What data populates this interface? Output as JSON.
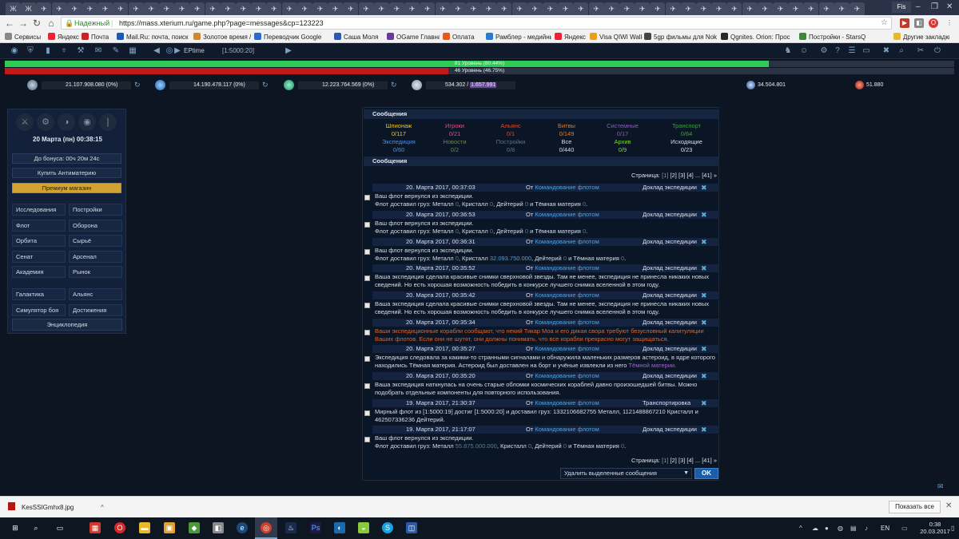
{
  "browser": {
    "tab_glyphs": [
      "Ж",
      "Ж",
      "✈",
      "✈",
      "✈",
      "✈",
      "✈",
      "✈",
      "✈",
      "✈",
      "✈",
      "✈",
      "✈",
      "✈",
      "✈",
      "✈",
      "✈",
      "✈",
      "✈",
      "✈",
      "✈",
      "✈",
      "✈",
      "✈",
      "✈",
      "✈",
      "✈",
      "✈",
      "✈",
      "✈",
      "✈",
      "✈",
      "✈",
      "✈",
      "✈",
      "✈",
      "✈",
      "✈",
      "✈",
      "✈",
      "✈",
      "✈",
      "✈",
      "✈",
      "✈",
      "✈",
      "✈",
      "✈",
      "✈",
      "✈",
      "✈",
      "✈",
      "✈",
      "✈",
      "✈",
      "✈",
      "✈",
      "✈"
    ],
    "profile": "Fis",
    "security_label": "Надежный",
    "url": "https://mass.xterium.ru/game.php?page=messages&cp=123223",
    "bookmarks": [
      "Сервисы",
      "Яндекс",
      "Почта",
      "Mail.Ru: почта, поиск",
      "Золотое время / Gol",
      "Переводчик Google",
      "Саша Моля",
      "OGame Главная",
      "Оплата",
      "Рамблер - медийный",
      "Яндекс",
      "Visa QIWI Wallet",
      "5gp фильмы для Nok",
      "Qgnites. Orion: Прос",
      "Постройки - StarsQ",
      "Другие закладки"
    ],
    "colors": {
      "secure": "#2a8a2a"
    }
  },
  "game": {
    "ep_name": "EPtime",
    "ep_coords": "[1:5000:20]",
    "level1": {
      "text": "81 Уровень (80.44%)",
      "progress_pct": 80.44
    },
    "level2": {
      "text": "46 Уровень (46.75%)",
      "progress_pct": 46.75
    },
    "resources": {
      "metal": "21.107.908.080 (0%)",
      "crystal": "14.190.478.117 (0%)",
      "deuterium": "12.223.764.569 (0%)",
      "energy_used": "534.302 / ",
      "energy_total": "1.657.991",
      "darkmatter": "34.504.801",
      "antimatter": "51.880"
    },
    "side": {
      "datetime": "20 Марта (пн) 00:38:15",
      "bonus": "До бонуса: 00ч 20м 24с",
      "buy_antimatter": "Купить Антиматерию",
      "premium": "Премиум магазин",
      "nav": [
        [
          "Исследования",
          "Постройки"
        ],
        [
          "Флот",
          "Оборона"
        ],
        [
          "Орбита",
          "Сырьё"
        ],
        [
          "Сенат",
          "Арсенал"
        ],
        [
          "Академия",
          "Рынок"
        ]
      ],
      "nav2": [
        [
          "Галактика",
          "Альянс"
        ],
        [
          "Симулятор боя",
          "Достижения"
        ]
      ],
      "encyclopedia": "Энциклопедия"
    },
    "messages": {
      "header": "Сообщения",
      "header2": "Сообщения",
      "categories": [
        {
          "name": "Шпионаж",
          "count": "0/117",
          "color": "#e8c531"
        },
        {
          "name": "Игроки",
          "count": "0/21",
          "color": "#e64c8c"
        },
        {
          "name": "Альянс",
          "count": "0/1",
          "color": "#e24a2a"
        },
        {
          "name": "Битвы",
          "count": "0/149",
          "color": "#e87a1e"
        },
        {
          "name": "Системные",
          "count": "0/17",
          "color": "#8e5ac4"
        },
        {
          "name": "Транспорт",
          "count": "0/64",
          "color": "#3e9e3e"
        },
        {
          "name": "Экспедиция",
          "count": "0/60",
          "color": "#4e8ee0"
        },
        {
          "name": "Новости",
          "count": "0/2",
          "color": "#6a8a4e"
        },
        {
          "name": "Постройки",
          "count": "0/8",
          "color": "#5f6f86"
        },
        {
          "name": "Все",
          "count": "0/440",
          "color": "#d6dee8"
        },
        {
          "name": "Архив",
          "count": "0/9",
          "color": "#7ed83a"
        },
        {
          "name": "Исходящие",
          "count": "0/23",
          "color": "#d6dee8"
        }
      ],
      "pager": {
        "label": "Страница:",
        "p1": "[1]",
        "p2": "[2]",
        "p3": "[3]",
        "p4": "[4]",
        "dots": "...",
        "plast": "[41]",
        "arrow": "»"
      },
      "from_prefix": "От",
      "items": [
        {
          "date": "20. Марта 2017, 00:37:03",
          "from": "Командование флотом",
          "subject": "Доклад экспедиции",
          "l1": "Ваш флот вернулся из экспедиции.",
          "g1": "Флот доставил груз: Металл",
          "v1": "0",
          ", Кристалл": ", Кристалл",
          "v2": "0",
          "dt": ", Дейтерий",
          "v3": "0",
          "tm": "и Тёмная материя",
          "v4": "0"
        },
        {
          "date": "20. Марта 2017, 00:36:53",
          "from": "Командование флотом",
          "subject": "Доклад экспедиции",
          "l1": "Ваш флот вернулся из экспедиции.",
          "g1": "Флот доставил груз: Металл",
          "v1": "0",
          "v2": "0",
          "v3": "0",
          "v4": "0"
        },
        {
          "date": "20. Марта 2017, 00:36:31",
          "from": "Командование флотом",
          "subject": "Доклад экспедиции",
          "l1": "Ваш флот вернулся из экспедиции.",
          "g1": "Флот доставил груз: Металл",
          "v1": "0",
          "v2": "32.093.750.000",
          "v3": "0",
          "v4": "0"
        },
        {
          "date": "20. Марта 2017, 00:35:52",
          "from": "Командование флотом",
          "subject": "Доклад экспедиции",
          "text": "Ваша экспедиция сделала красивые снимки сверхновой звезды. Там не менее, экспедиция не принесла никаких новых сведений. Но есть хорошая возможность победить в конкурсе лучшего снимка вселенной в этом году."
        },
        {
          "date": "20. Марта 2017, 00:35:42",
          "from": "Командование флотом",
          "subject": "Доклад экспедиции",
          "text": "Ваша экспедиция сделала красивые снимки сверхновой звезды. Там не менее, экспедиция не принесла никаких новых сведений. Но есть хорошая возможность победить в конкурсе лучшего снимка вселенной в этом году."
        },
        {
          "date": "20. Марта 2017, 00:35:34",
          "from": "Командование флотом",
          "subject": "Доклад экспедиции",
          "text": "Ваши экспедиционные корабли сообщают, что некий Тикар Моа и его дикая свора требуют безусловный капитуляции Ваших флотов. Если они не шутят, они должны понимать, что все корабли прекрасно могут защищаться."
        },
        {
          "date": "20. Марта 2017, 00:35:27",
          "from": "Командование флотом",
          "subject": "Доклад экспедиции",
          "text": "Экспедиция следовала за какими-то странными сигналами и обнаружила маленьких размеров астероид, в ядре которого находились Тёмная материя. Астероид был доставлен на борт и учёные извлекли из него",
          "link": "Тёмной материи."
        },
        {
          "date": "20. Марта 2017, 00:35:20",
          "from": "Командование флотом",
          "subject": "Доклад экспедиции",
          "text": "Ваша экспедиция наткнулась на очень старые обломки космических кораблей давно произошедшей битвы. Можно подобрать отдельные компоненты для повторного использования."
        },
        {
          "date": "19. Марта 2017, 21:30:37",
          "from": "Командование флотом",
          "subject": "Транспортировка",
          "text": "Мирный флот из [1:5000:19] достиг [1:5000:20] и доставил груз: 1332106682755 Металл, 1121488867210 Кристалл и 462507336236 Дейтерий."
        },
        {
          "date": "19. Марта 2017, 21:17:07",
          "from": "Командование флотом",
          "subject": "Доклад экспедиции",
          "l1": "Ваш флот вернулся из экспедиции.",
          "g1": "Флот доставил груз: Металл",
          "v1": "55.875.000.000",
          "v2": "0",
          "v3": "0",
          "v4": "0"
        }
      ],
      "labels": {
        "crystal": ", Кристалл",
        "deut": ", Дейтерий",
        "dm": "и Тёмная материя",
        "dot": "."
      },
      "delete_option": "Удалить выделенные сообщения",
      "ok": "OK"
    }
  },
  "download": {
    "file": "KesSSIGmhx8.jpg",
    "show_all": "Показать все"
  },
  "taskbar": {
    "lang": "EN",
    "time": "0:38",
    "date": "20.03.2017"
  }
}
